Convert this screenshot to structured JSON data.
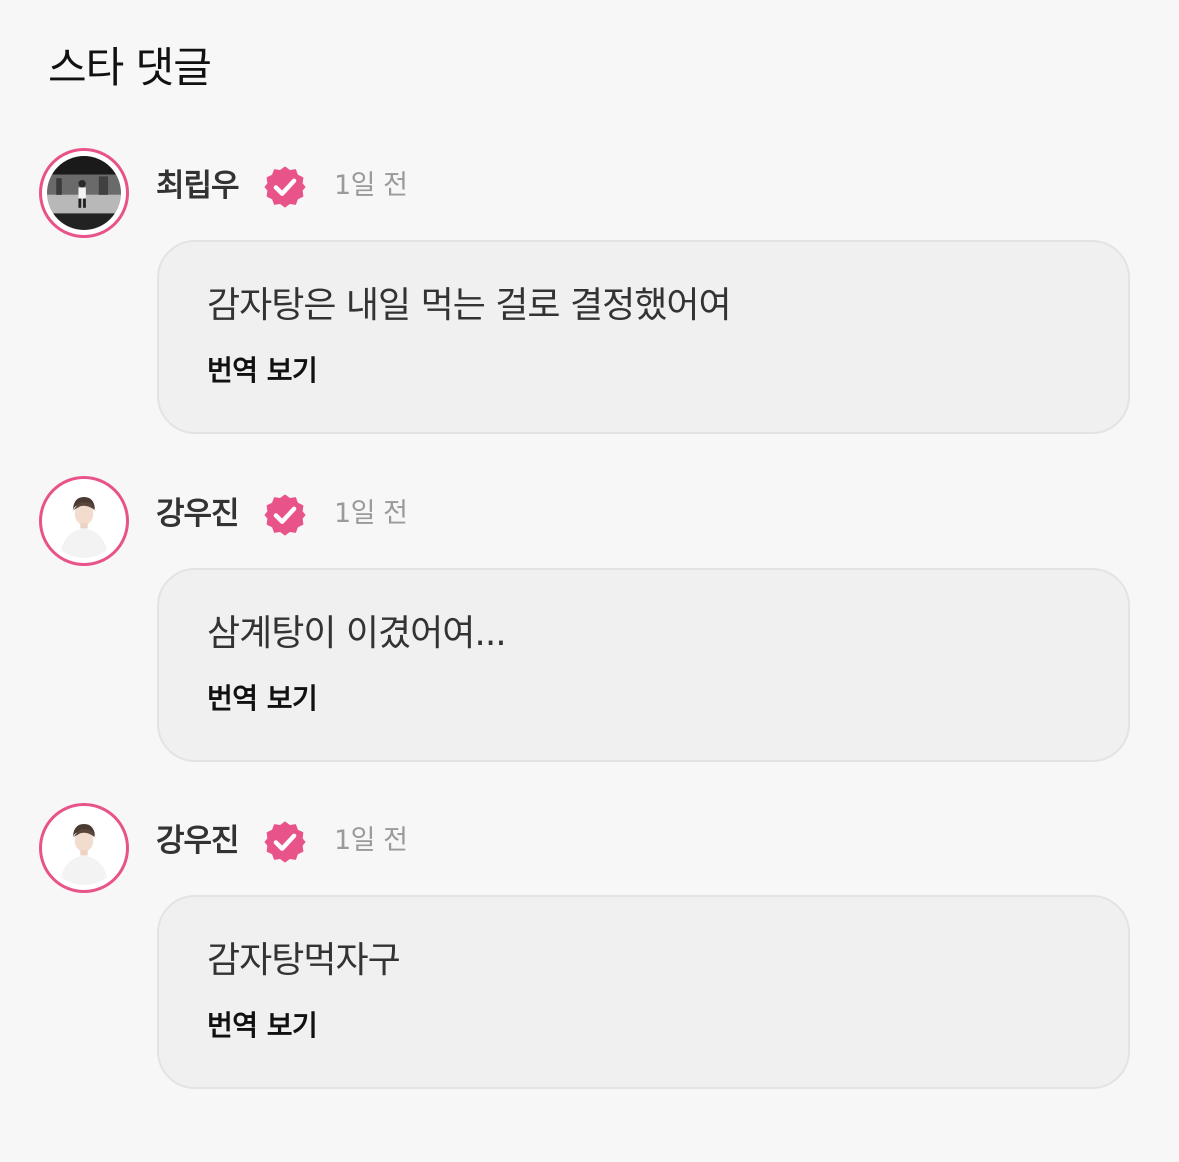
{
  "header": {
    "title": "스타 댓글"
  },
  "colors": {
    "accent": "#e8548a",
    "background": "#f7f7f7",
    "bubble": "#f0f0f0",
    "muted_text": "#9a9a9a"
  },
  "comments": [
    {
      "author": "최립우",
      "verified_icon": "verified-check-icon",
      "time": "1일 전",
      "message": "감자탕은 내일 먹는 걸로 결정했어여",
      "translate_label": "번역 보기"
    },
    {
      "author": "강우진",
      "verified_icon": "verified-check-icon",
      "time": "1일 전",
      "message": "삼계탕이 이겼어여...",
      "translate_label": "번역 보기"
    },
    {
      "author": "강우진",
      "verified_icon": "verified-check-icon",
      "time": "1일 전",
      "message": "감자탕먹자구",
      "translate_label": "번역 보기"
    }
  ]
}
